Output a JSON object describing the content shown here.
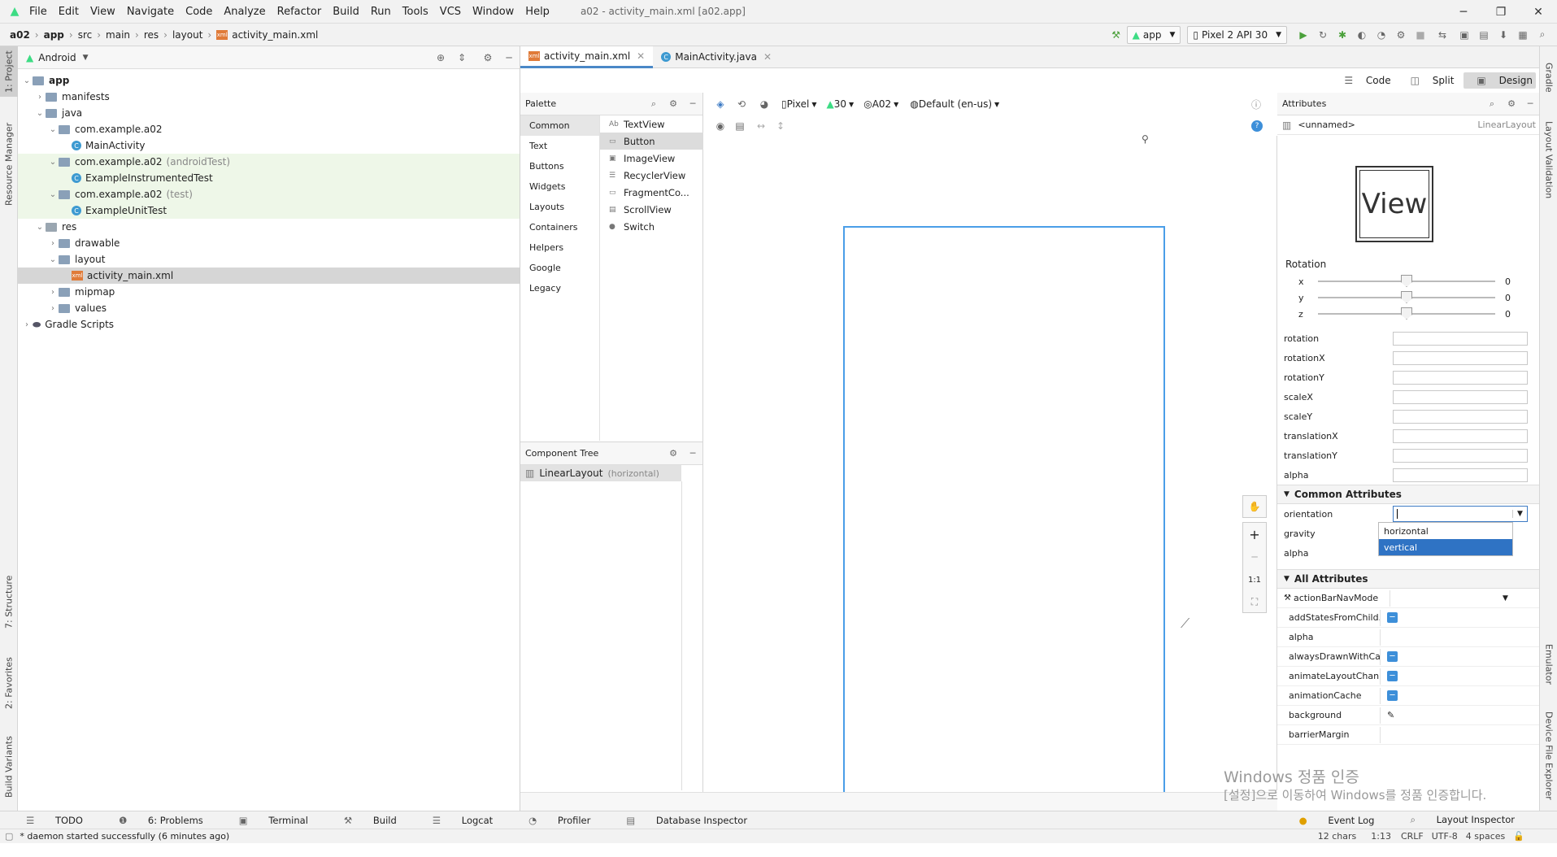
{
  "menubar": {
    "items": [
      "File",
      "Edit",
      "View",
      "Navigate",
      "Code",
      "Analyze",
      "Refactor",
      "Build",
      "Run",
      "Tools",
      "VCS",
      "Window",
      "Help"
    ],
    "title": "a02 - activity_main.xml [a02.app]"
  },
  "breadcrumb": [
    "a02",
    "app",
    "src",
    "main",
    "res",
    "layout",
    "activity_main.xml"
  ],
  "run_config": {
    "module": "app",
    "device": "Pixel 2 API 30"
  },
  "left_stripe": [
    "1: Project",
    "Resource Manager",
    "7: Structure",
    "2: Favorites",
    "Build Variants"
  ],
  "right_stripe": [
    "Gradle",
    "Layout Validation",
    "Emulator",
    "Device File Explorer"
  ],
  "project": {
    "view": "Android",
    "tree": [
      {
        "label": "app",
        "indent": 0,
        "kind": "module",
        "open": true,
        "bold": true
      },
      {
        "label": "manifests",
        "indent": 1,
        "kind": "folder",
        "open": false
      },
      {
        "label": "java",
        "indent": 1,
        "kind": "folder",
        "open": true
      },
      {
        "label": "com.example.a02",
        "indent": 2,
        "kind": "folder",
        "open": true
      },
      {
        "label": "MainActivity",
        "indent": 3,
        "kind": "class"
      },
      {
        "label": "com.example.a02",
        "suffix": "(androidTest)",
        "indent": 2,
        "kind": "folder",
        "open": true,
        "green": true
      },
      {
        "label": "ExampleInstrumentedTest",
        "indent": 3,
        "kind": "class",
        "green": true
      },
      {
        "label": "com.example.a02",
        "suffix": "(test)",
        "indent": 2,
        "kind": "folder",
        "open": true,
        "green": true
      },
      {
        "label": "ExampleUnitTest",
        "indent": 3,
        "kind": "class",
        "green": true
      },
      {
        "label": "res",
        "indent": 1,
        "kind": "res",
        "open": true
      },
      {
        "label": "drawable",
        "indent": 2,
        "kind": "folder",
        "open": false
      },
      {
        "label": "layout",
        "indent": 2,
        "kind": "folder",
        "open": true
      },
      {
        "label": "activity_main.xml",
        "indent": 3,
        "kind": "xml",
        "selected": true
      },
      {
        "label": "mipmap",
        "indent": 2,
        "kind": "folder",
        "open": false
      },
      {
        "label": "values",
        "indent": 2,
        "kind": "folder",
        "open": false
      },
      {
        "label": "Gradle Scripts",
        "indent": 0,
        "kind": "gradle",
        "open": false
      }
    ]
  },
  "editor_tabs": [
    "activity_main.xml",
    "MainActivity.java"
  ],
  "view_modes": [
    "Code",
    "Split",
    "Design"
  ],
  "palette": {
    "title": "Palette",
    "categories": [
      "Common",
      "Text",
      "Buttons",
      "Widgets",
      "Layouts",
      "Containers",
      "Helpers",
      "Google",
      "Legacy"
    ],
    "items": [
      {
        "icon": "Ab",
        "label": "TextView"
      },
      {
        "icon": "▭",
        "label": "Button"
      },
      {
        "icon": "▣",
        "label": "ImageView"
      },
      {
        "icon": "☰",
        "label": "RecyclerView"
      },
      {
        "icon": "▭",
        "label": "FragmentCo..."
      },
      {
        "icon": "▤",
        "label": "ScrollView"
      },
      {
        "icon": "●",
        "label": "Switch"
      }
    ]
  },
  "design_toolbar": {
    "device": "Pixel",
    "api": "30",
    "theme": "A02",
    "locale": "Default (en-us)"
  },
  "component_tree": {
    "title": "Component Tree",
    "root": "LinearLayout",
    "root_suffix": "(horizontal)"
  },
  "attributes": {
    "title": "Attributes",
    "id": "<unnamed>",
    "type": "LinearLayout",
    "preview": "View",
    "rotation_title": "Rotation",
    "sliders": [
      {
        "axis": "x",
        "value": "0"
      },
      {
        "axis": "y",
        "value": "0"
      },
      {
        "axis": "z",
        "value": "0"
      }
    ],
    "transform_fields": [
      "rotation",
      "rotationX",
      "rotationY",
      "scaleX",
      "scaleY",
      "translationX",
      "translationY",
      "alpha"
    ],
    "common_title": "Common Attributes",
    "common_fields": [
      "orientation",
      "gravity",
      "alpha"
    ],
    "dropdown_options": [
      "horizontal",
      "vertical"
    ],
    "all_title": "All Attributes",
    "all_fields": [
      {
        "label": "actionBarNavMode",
        "control": "dropdown"
      },
      {
        "label": "addStatesFromChild...",
        "control": "minus"
      },
      {
        "label": "alpha",
        "control": "none"
      },
      {
        "label": "alwaysDrawnWithCa...",
        "control": "minus"
      },
      {
        "label": "animateLayoutChan...",
        "control": "minus"
      },
      {
        "label": "animationCache",
        "control": "minus"
      },
      {
        "label": "background",
        "control": "picker"
      },
      {
        "label": "barrierMargin",
        "control": "none"
      }
    ]
  },
  "zoom": {
    "ratio": "1:1"
  },
  "watermark": {
    "line1": "Windows 정품 인증",
    "line2": "[설정]으로 이동하여 Windows를 정품 인증합니다."
  },
  "tool_windows": [
    "TODO",
    "6: Problems",
    "Terminal",
    "Build",
    "Logcat",
    "Profiler",
    "Database Inspector"
  ],
  "tool_windows_right": [
    "Event Log",
    "Layout Inspector"
  ],
  "status": {
    "message": "* daemon started successfully (6 minutes ago)",
    "chars": "12 chars",
    "pos": "1:13",
    "eol": "CRLF",
    "enc": "UTF-8",
    "indent": "4 spaces"
  },
  "colors": {
    "accent": "#4a88c7",
    "selection": "#2f73c4",
    "test_green": "#eef7e8"
  }
}
